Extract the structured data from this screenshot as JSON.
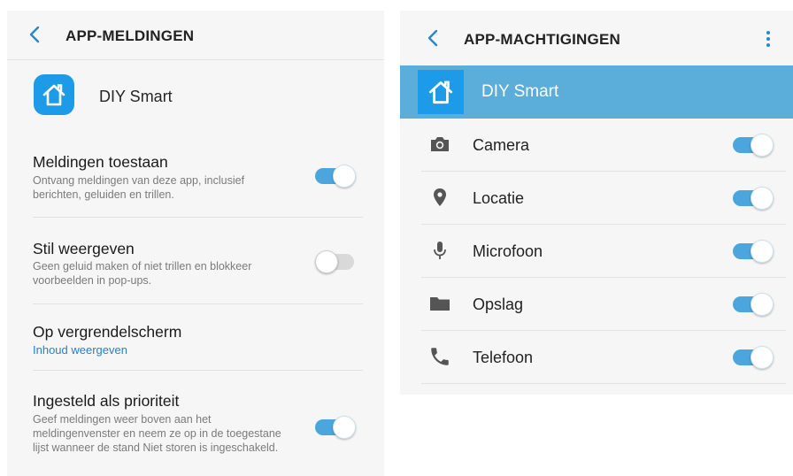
{
  "notifications_screen": {
    "title": "APP-MELDINGEN",
    "app_name": "DIY Smart",
    "settings": [
      {
        "title": "Meldingen toestaan",
        "description": "Ontvang meldingen van deze app, inclusief berichten, geluiden en trillen.",
        "toggle": "on"
      },
      {
        "title": "Stil weergeven",
        "description": "Geen geluid maken of niet trillen en blokkeer voorbeelden in pop-ups.",
        "toggle": "off"
      },
      {
        "title": "Op vergrendelscherm",
        "link": "Inhoud weergeven"
      },
      {
        "title": "Ingesteld als prioriteit",
        "description": "Geef meldingen weer boven aan het meldingenvenster en neem ze op in de toegestane lijst wanneer de stand Niet storen is ingeschakeld.",
        "toggle": "on"
      }
    ]
  },
  "permissions_screen": {
    "title": "APP-MACHTIGINGEN",
    "app_name": "DIY Smart",
    "permissions": [
      {
        "label": "Camera",
        "icon": "camera-icon",
        "toggle": "on"
      },
      {
        "label": "Locatie",
        "icon": "location-pin-icon",
        "toggle": "on"
      },
      {
        "label": "Microfoon",
        "icon": "microphone-icon",
        "toggle": "on"
      },
      {
        "label": "Opslag",
        "icon": "folder-icon",
        "toggle": "on"
      },
      {
        "label": "Telefoon",
        "icon": "phone-icon",
        "toggle": "on"
      }
    ]
  },
  "colors": {
    "accent": "#4aa6dc",
    "app_icon": "#1e9be8",
    "banner": "#5aaed9",
    "link": "#2a7fc0",
    "toggle_off": "#d9d9d9"
  }
}
